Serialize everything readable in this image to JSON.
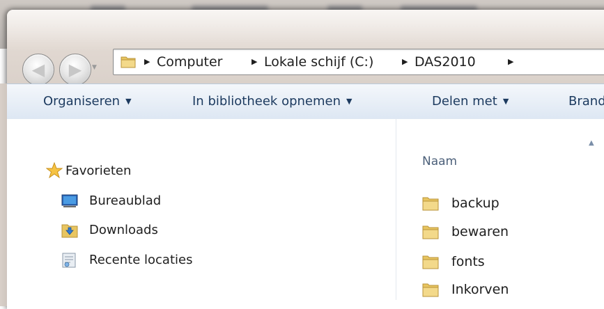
{
  "address_bar": {
    "crumbs": [
      "Computer",
      "Lokale schijf (C:)",
      "DAS2010"
    ]
  },
  "commands": {
    "organize": "Organiseren",
    "include_library": "In bibliotheek opnemen",
    "share_with": "Delen met",
    "burn": "Brand"
  },
  "navigation": {
    "favorites": "Favorieten",
    "items": [
      "Bureaublad",
      "Downloads",
      "Recente locaties"
    ]
  },
  "file_list": {
    "column_name": "Naam",
    "items": [
      "backup",
      "bewaren",
      "fonts",
      "Inkorven"
    ]
  },
  "colors": {
    "command_text": "#1c3a5f",
    "folder": "#e8c560"
  }
}
